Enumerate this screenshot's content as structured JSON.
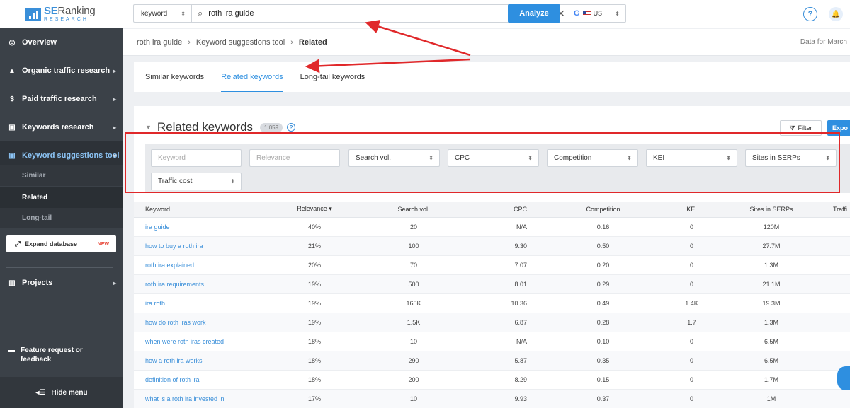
{
  "logo": {
    "brand_se": "SE",
    "brand_ranking": "Ranking",
    "sub": "RESEARCH"
  },
  "sidebar": {
    "items": [
      {
        "label": "Overview"
      },
      {
        "label": "Organic traffic research"
      },
      {
        "label": "Paid traffic research"
      },
      {
        "label": "Keywords research"
      },
      {
        "label": "Keyword suggestions tool"
      }
    ],
    "sub_items": [
      {
        "label": "Similar"
      },
      {
        "label": "Related"
      },
      {
        "label": "Long-tail"
      }
    ],
    "expand": {
      "label": "Expand database",
      "badge": "NEW"
    },
    "projects": "Projects",
    "feature": "Feature request or feedback",
    "hide_menu": "Hide menu"
  },
  "search": {
    "type": "keyword",
    "value": "roth ira guide",
    "region": "US",
    "analyze_label": "Analyze"
  },
  "topbar": {
    "help": "?"
  },
  "breadcrumb": {
    "items": [
      "roth ira guide",
      "Keyword suggestions tool",
      "Related"
    ],
    "data_for": "Data for March"
  },
  "tabs": [
    "Similar keywords",
    "Related keywords",
    "Long-tail keywords"
  ],
  "section": {
    "title": "Related keywords",
    "count": "1,059",
    "filter_label": "Filter",
    "export_label": "Expo"
  },
  "filters": {
    "keyword_placeholder": "Keyword",
    "relevance_placeholder": "Relevance",
    "search_vol": "Search vol.",
    "cpc": "CPC",
    "competition": "Competition",
    "kei": "KEI",
    "sites": "Sites in SERPs",
    "traffic_cost": "Traffic cost"
  },
  "table": {
    "headers": [
      "Keyword",
      "Relevance ▾",
      "Search vol.",
      "CPC",
      "Competition",
      "KEI",
      "Sites in SERPs",
      "Traffi"
    ],
    "rows": [
      [
        "ira guide",
        "40%",
        "20",
        "N/A",
        "0.16",
        "0",
        "120M"
      ],
      [
        "how to buy a roth ira",
        "21%",
        "100",
        "9.30",
        "0.50",
        "0",
        "27.7M"
      ],
      [
        "roth ira explained",
        "20%",
        "70",
        "7.07",
        "0.20",
        "0",
        "1.3M"
      ],
      [
        "roth ira requirements",
        "19%",
        "500",
        "8.01",
        "0.29",
        "0",
        "21.1M"
      ],
      [
        "ira roth",
        "19%",
        "165K",
        "10.36",
        "0.49",
        "1.4K",
        "19.3M"
      ],
      [
        "how do roth iras work",
        "19%",
        "1.5K",
        "6.87",
        "0.28",
        "1.7",
        "1.3M"
      ],
      [
        "when were roth iras created",
        "18%",
        "10",
        "N/A",
        "0.10",
        "0",
        "6.5M"
      ],
      [
        "how a roth ira works",
        "18%",
        "290",
        "5.87",
        "0.35",
        "0",
        "6.5M"
      ],
      [
        "definition of roth ira",
        "18%",
        "200",
        "8.29",
        "0.15",
        "0",
        "1.7M"
      ],
      [
        "what is a roth ira invested in",
        "17%",
        "10",
        "9.93",
        "0.37",
        "0",
        "1M"
      ]
    ]
  },
  "colors": {
    "accent": "#2e8fe0",
    "sidebar": "#3b4148",
    "annotation": "#e0282a"
  }
}
